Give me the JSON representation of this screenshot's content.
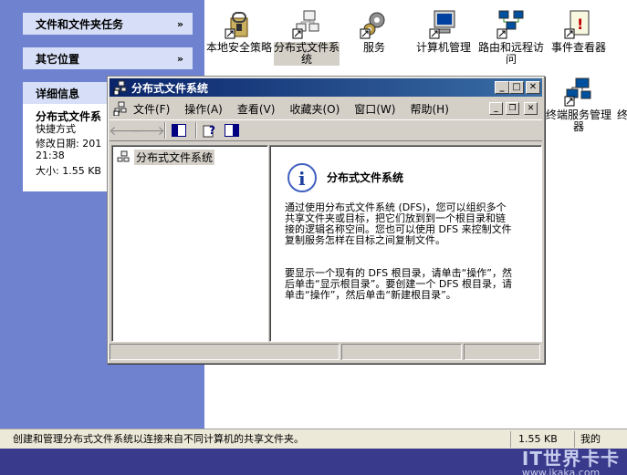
{
  "left_pane": {
    "tasks_header": "文件和文件夹任务",
    "other_places_header": "其它位置",
    "details_header": "详细信息",
    "details": {
      "name": "分布式文件系",
      "type": "快捷方式",
      "modified_label": "修改日期: 201",
      "modified_time": "21:38",
      "size": "大小: 1.55 KB"
    }
  },
  "icons": [
    {
      "label": "本地安全策略",
      "name": "local-security-policy-icon"
    },
    {
      "label": "分布式文件系统",
      "name": "dfs-icon"
    },
    {
      "label": "服务",
      "name": "services-icon"
    },
    {
      "label": "计算机管理",
      "name": "computer-management-icon"
    },
    {
      "label": "路由和远程访问",
      "name": "routing-remote-access-icon"
    },
    {
      "label": "事件查看器",
      "name": "event-viewer-icon"
    },
    {
      "label": "终端服务管理器",
      "name": "terminal-services-manager-icon"
    },
    {
      "label": "终",
      "name": "terminal-icon"
    }
  ],
  "mmc": {
    "title": "分布式文件系统",
    "menus": [
      "文件(F)",
      "操作(A)",
      "查看(V)",
      "收藏夹(O)",
      "窗口(W)",
      "帮助(H)"
    ],
    "tree_item": "分布式文件系统",
    "content_title": "分布式文件系统",
    "para1": "通过使用分布式文件系统 (DFS)，您可以组织多个共享文件夹或目标，把它们放到到一个根目录和链接的逻辑名称空间。您也可以使用 DFS 来控制文件复制服务怎样在目标之间复制文件。",
    "para2": "要显示一个现有的 DFS 根目录，请单击“操作”，然后单击“显示根目录”。要创建一个 DFS 根目录，请单击“操作”，然后单击“新建根目录”。"
  },
  "status_bar": {
    "text": "创建和管理分布式文件系统以连接来自不同计算机的共享文件夹。",
    "size": "1.55 KB",
    "extra": "我的"
  },
  "watermark": {
    "big": "IT世界卡卡",
    "small": "www.ikaka.com"
  }
}
